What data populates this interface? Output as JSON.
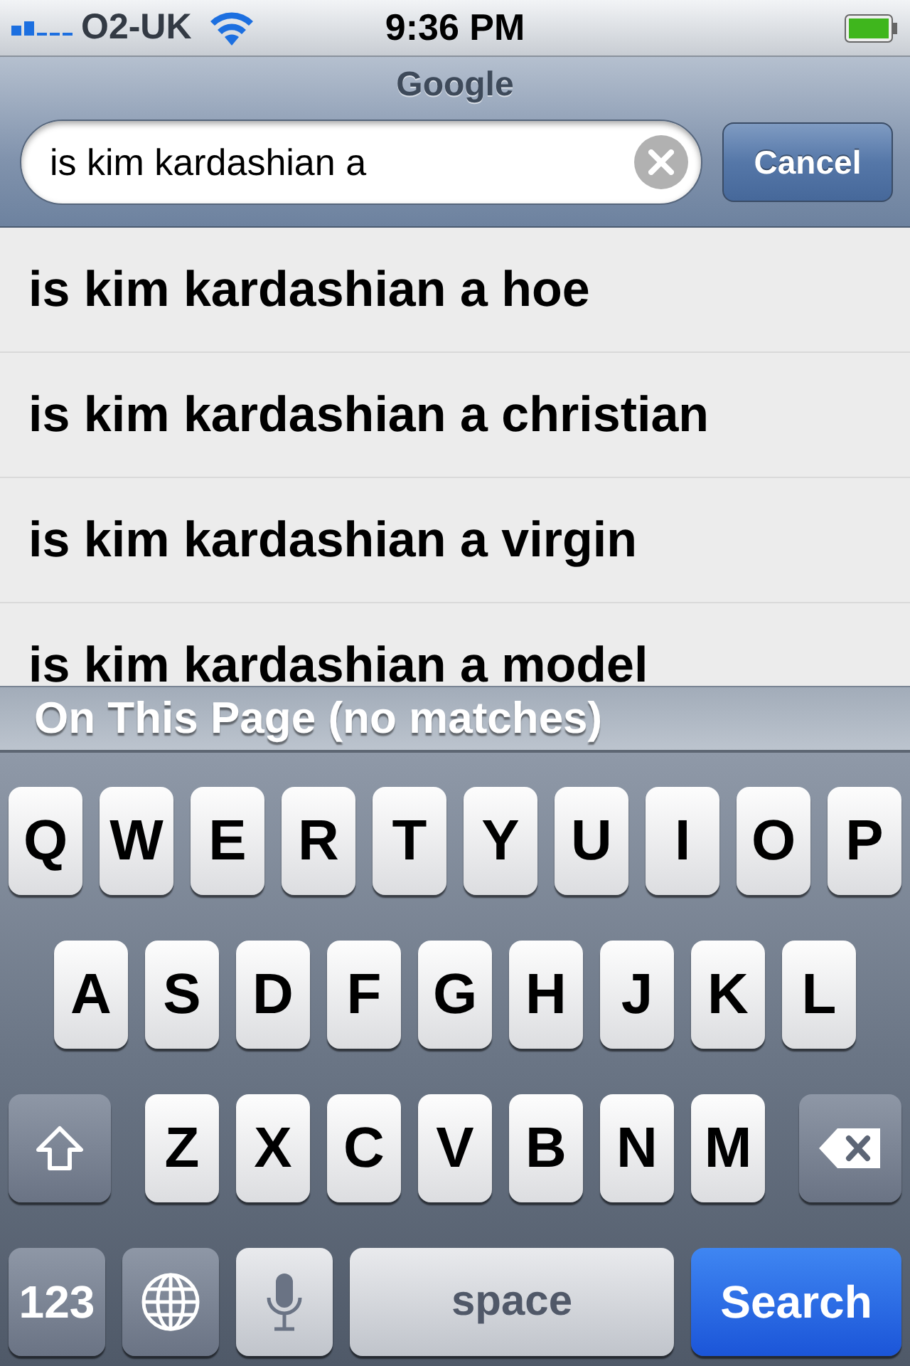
{
  "status_bar": {
    "carrier": "O2-UK",
    "time": "9:36 PM"
  },
  "search_bar": {
    "title": "Google",
    "query": "is kim kardashian a",
    "cancel": "Cancel"
  },
  "suggestions": [
    "is kim kardashian a hoe",
    "is kim kardashian a christian",
    "is kim kardashian a virgin",
    "is kim kardashian a model"
  ],
  "section_header": "On This Page (no matches)",
  "keyboard": {
    "rows": [
      [
        {
          "kind": "letter",
          "label": "Q"
        },
        {
          "kind": "letter",
          "label": "W"
        },
        {
          "kind": "letter",
          "label": "E"
        },
        {
          "kind": "letter",
          "label": "R"
        },
        {
          "kind": "letter",
          "label": "T"
        },
        {
          "kind": "letter",
          "label": "Y"
        },
        {
          "kind": "letter",
          "label": "U"
        },
        {
          "kind": "letter",
          "label": "I"
        },
        {
          "kind": "letter",
          "label": "O"
        },
        {
          "kind": "letter",
          "label": "P"
        }
      ],
      [
        {
          "kind": "letter",
          "label": "A"
        },
        {
          "kind": "letter",
          "label": "S"
        },
        {
          "kind": "letter",
          "label": "D"
        },
        {
          "kind": "letter",
          "label": "F"
        },
        {
          "kind": "letter",
          "label": "G"
        },
        {
          "kind": "letter",
          "label": "H"
        },
        {
          "kind": "letter",
          "label": "J"
        },
        {
          "kind": "letter",
          "label": "K"
        },
        {
          "kind": "letter",
          "label": "L"
        }
      ],
      [
        {
          "kind": "shift"
        },
        {
          "kind": "letter",
          "label": "Z"
        },
        {
          "kind": "letter",
          "label": "X"
        },
        {
          "kind": "letter",
          "label": "C"
        },
        {
          "kind": "letter",
          "label": "V"
        },
        {
          "kind": "letter",
          "label": "B"
        },
        {
          "kind": "letter",
          "label": "N"
        },
        {
          "kind": "letter",
          "label": "M"
        },
        {
          "kind": "delete"
        }
      ]
    ],
    "bottom_row": [
      {
        "kind": "numbers",
        "label": "123"
      },
      {
        "kind": "globe"
      },
      {
        "kind": "mic"
      },
      {
        "kind": "space",
        "label": "space"
      },
      {
        "kind": "action",
        "label": "Search"
      }
    ]
  }
}
